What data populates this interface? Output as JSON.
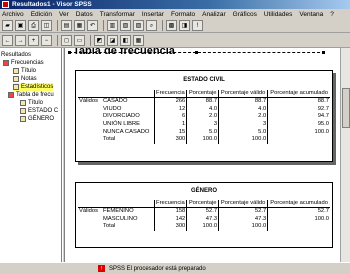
{
  "window": {
    "title": "Resultados1 - Visor SPSS"
  },
  "menu": [
    "Archivo",
    "Edición",
    "Ver",
    "Datos",
    "Transformar",
    "Insertar",
    "Formato",
    "Analizar",
    "Gráficos",
    "Utilidades",
    "Ventana",
    "?"
  ],
  "outline": {
    "items": [
      {
        "label": "Resultados",
        "icon": "folder-icon"
      },
      {
        "label": "Frecuencias",
        "icon": "book-icon"
      },
      {
        "label": "Título",
        "icon": "page-icon"
      },
      {
        "label": "Notas",
        "icon": "page-icon"
      },
      {
        "label": "Estadísticos",
        "icon": "page-icon"
      },
      {
        "label": "Tabla de frecu",
        "icon": "book-icon"
      },
      {
        "label": "Título",
        "icon": "page-icon"
      },
      {
        "label": "ESTADO C",
        "icon": "page-icon"
      },
      {
        "label": "GÉNERO",
        "icon": "page-icon"
      }
    ]
  },
  "content": {
    "heading": "Tabla de frecuencia",
    "table1": {
      "title": "ESTADO CIVIL",
      "columns": [
        "Frecuencia",
        "Porcentaje",
        "Porcentaje válido",
        "Porcentaje acumulado"
      ],
      "group_label": "Válidos",
      "rows": [
        {
          "label": "CASADO",
          "values": [
            "266",
            "88.7",
            "88.7",
            "88.7"
          ]
        },
        {
          "label": "VIUDO",
          "values": [
            "12",
            "4.0",
            "4.0",
            "92.7"
          ]
        },
        {
          "label": "DIVORCIADO",
          "values": [
            "6",
            "2.0",
            "2.0",
            "94.7"
          ]
        },
        {
          "label": "UNIÓN LIBRE",
          "values": [
            "1",
            "3",
            "3",
            "95.0"
          ]
        },
        {
          "label": "NUNCA CASADO",
          "values": [
            "15",
            "5.0",
            "5.0",
            "100.0"
          ]
        },
        {
          "label": "Total",
          "values": [
            "300",
            "100.0",
            "100.0",
            ""
          ]
        }
      ]
    },
    "table2": {
      "title": "GÉNERO",
      "columns": [
        "Frecuencia",
        "Porcentaje",
        "Porcentaje válido",
        "Porcentaje acumulado"
      ],
      "group_label": "Válidos",
      "rows": [
        {
          "label": "FEMENINO",
          "values": [
            "158",
            "52.7",
            "52.7",
            "52.7"
          ]
        },
        {
          "label": "MASCULINO",
          "values": [
            "142",
            "47.3",
            "47.3",
            "100.0"
          ]
        },
        {
          "label": "Total",
          "values": [
            "300",
            "100.0",
            "100.0",
            ""
          ]
        }
      ]
    }
  },
  "status": {
    "text": "SPSS El procesador está preparado"
  }
}
